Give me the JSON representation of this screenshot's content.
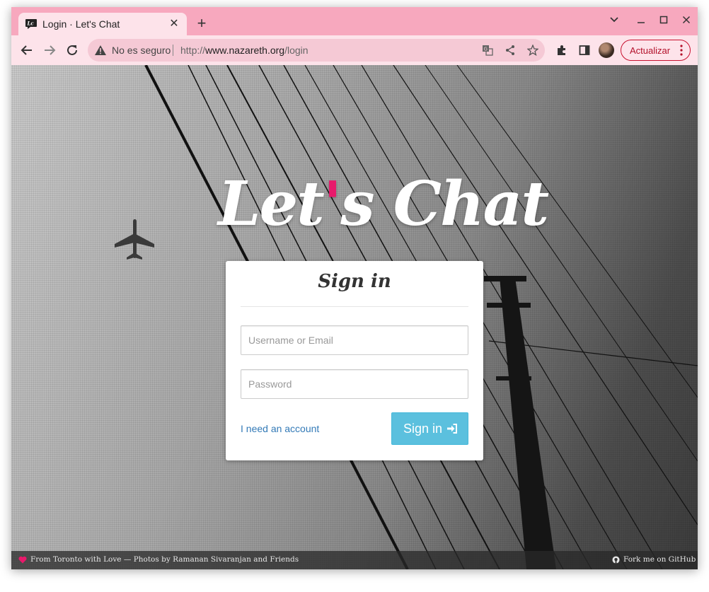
{
  "colors": {
    "tab_bar": "#f7a8be",
    "toolbar": "#fde3ea",
    "accent_pink": "#e8196b",
    "signin_button": "#5bc0de",
    "link": "#337ab7",
    "update_button_text": "#b3102a"
  },
  "browser": {
    "tab": {
      "title": "Login · Let's Chat",
      "favicon": "lets-chat-icon",
      "close": "✕"
    },
    "new_tab": "+",
    "window_controls": {
      "tab_search": "chevron-down-icon",
      "minimize": "–",
      "maximize": "□",
      "close": "✕"
    },
    "toolbar": {
      "security_text": "No es seguro",
      "url_scheme": "http://",
      "url_host": "www.nazareth.org",
      "url_path": "/login",
      "update_label": "Actualizar"
    }
  },
  "page": {
    "logo": {
      "part1": "Let",
      "apostrophe": "'",
      "part2": "s Chat"
    },
    "signin_card": {
      "title": "Sign in",
      "username_placeholder": "Username or Email",
      "password_placeholder": "Password",
      "account_link": "I need an account",
      "submit_label": "Sign in"
    },
    "footer": {
      "credit": "From Toronto with Love — Photos by Ramanan Sivaranjan and Friends",
      "github": "Fork me on GitHub »"
    }
  }
}
